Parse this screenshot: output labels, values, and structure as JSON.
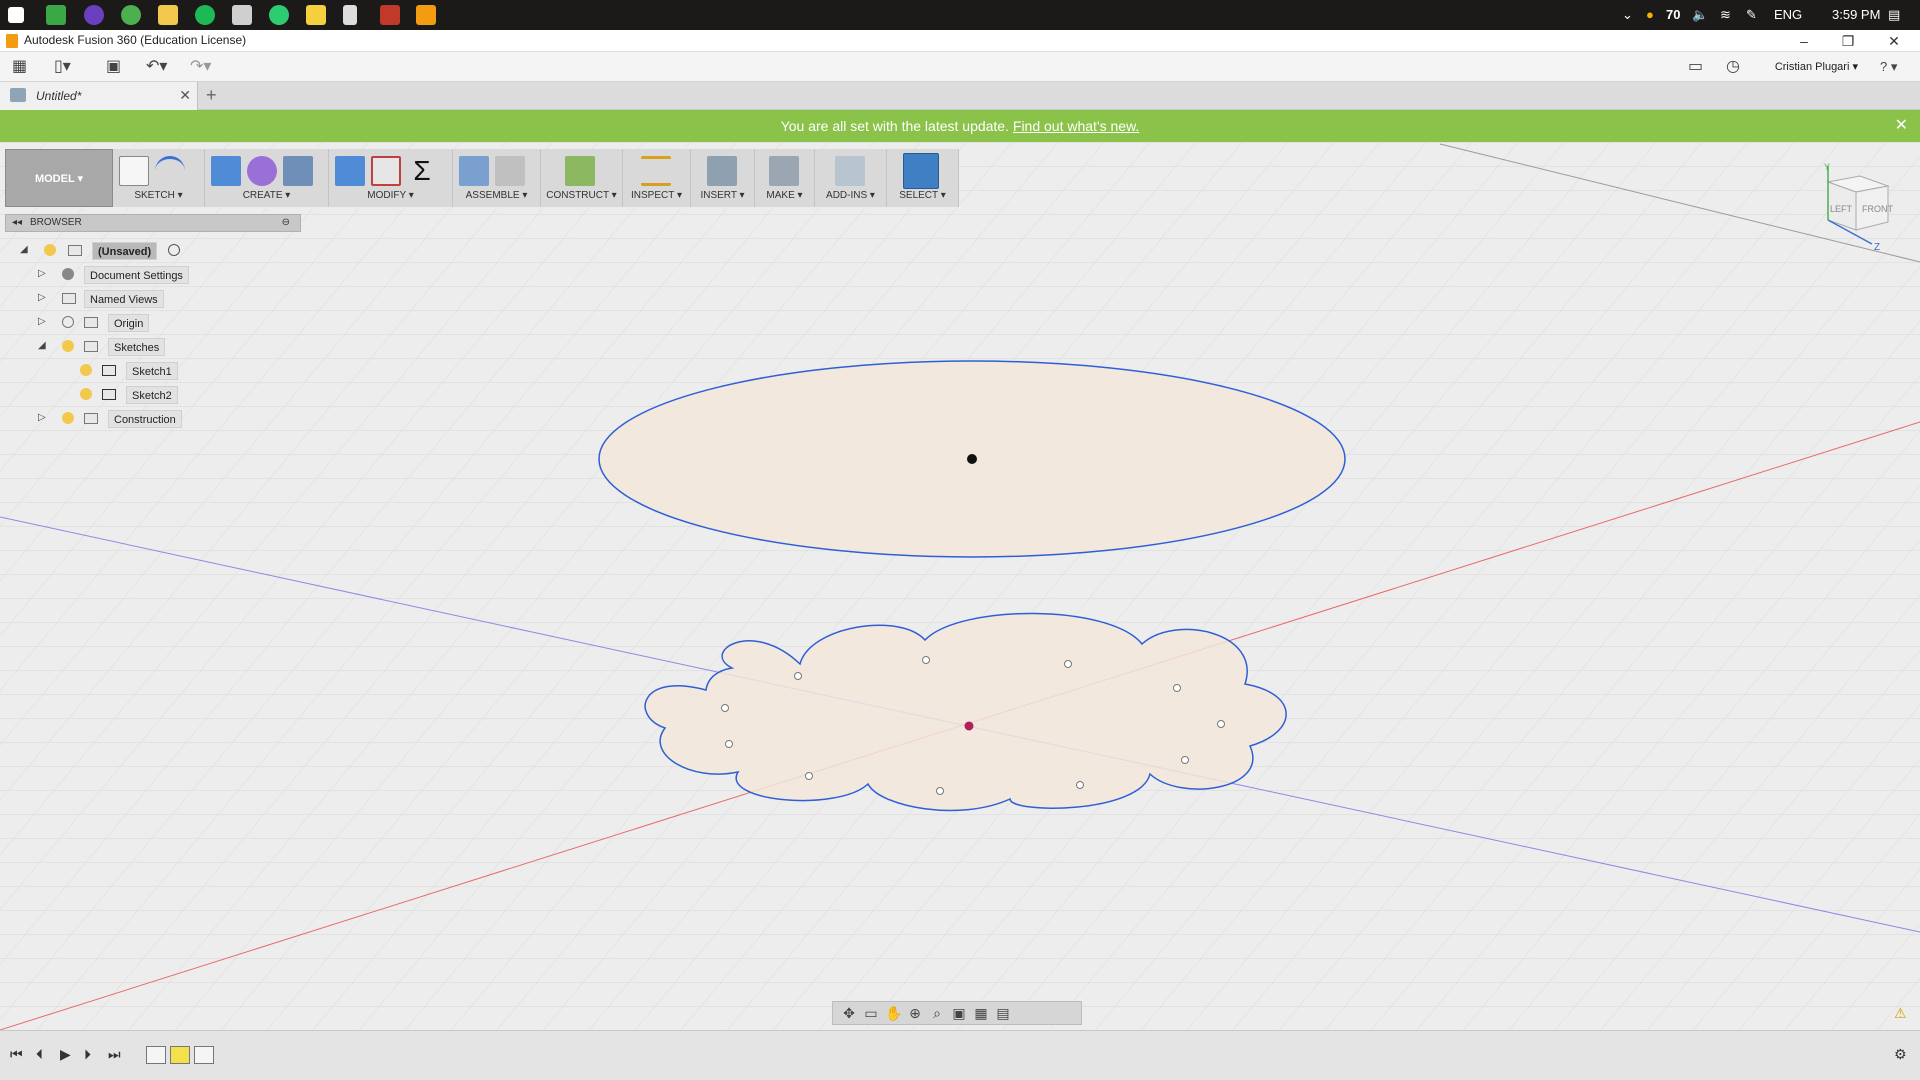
{
  "window": {
    "title": "Autodesk Fusion 360 (Education License)",
    "minimize": "–",
    "restore": "❐",
    "close": "✕"
  },
  "taskbar": {
    "temperature": "70",
    "language": "ENG",
    "time": "3:59 PM"
  },
  "quickaccess": {
    "user": "Cristian Plugari ▾",
    "help": "? ▾"
  },
  "doc_tab": {
    "label": "Untitled*",
    "close": "✕",
    "new": "+"
  },
  "notification": {
    "text": "You are all set with the latest update.",
    "link": "Find out what's new.",
    "close": "✕"
  },
  "toolbar": {
    "model": "MODEL ▾",
    "groups": [
      {
        "label": "SKETCH ▾"
      },
      {
        "label": "CREATE ▾"
      },
      {
        "label": "MODIFY ▾"
      },
      {
        "label": "ASSEMBLE ▾"
      },
      {
        "label": "CONSTRUCT ▾"
      },
      {
        "label": "INSPECT ▾"
      },
      {
        "label": "INSERT ▾"
      },
      {
        "label": "MAKE ▾"
      },
      {
        "label": "ADD-INS ▾"
      },
      {
        "label": "SELECT ▾"
      }
    ]
  },
  "browser": {
    "title": "BROWSER",
    "items": [
      {
        "label": "(Unsaved)"
      },
      {
        "label": "Document Settings"
      },
      {
        "label": "Named Views"
      },
      {
        "label": "Origin"
      },
      {
        "label": "Sketches"
      },
      {
        "label": "Sketch1"
      },
      {
        "label": "Sketch2"
      },
      {
        "label": "Construction"
      }
    ]
  },
  "viewcube": {
    "left": "LEFT",
    "front": "FRONT",
    "y": "Y",
    "z": "Z"
  },
  "colors": {
    "accent_green": "#8bc34a",
    "sketch_blue": "#2f5fd6",
    "sketch_fill": "#f2e6da",
    "axis_red": "#e06060",
    "axis_blue": "#7a7ae0"
  }
}
